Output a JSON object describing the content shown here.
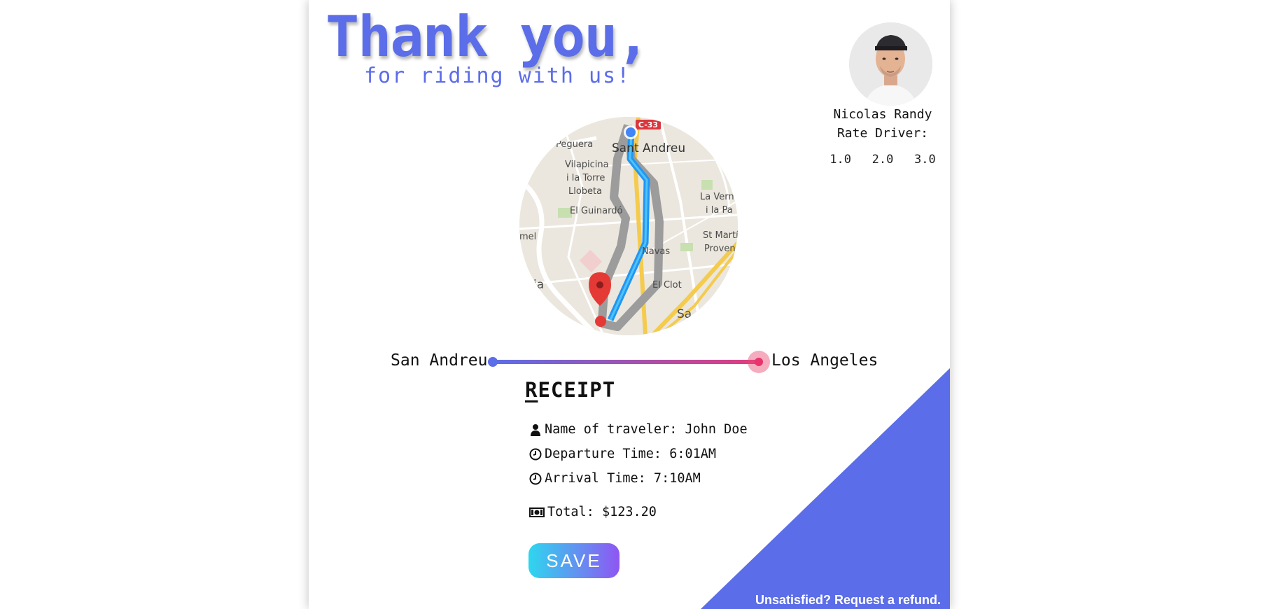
{
  "header": {
    "title": "Thank you,",
    "subtitle": "for riding with us!"
  },
  "driver": {
    "name": "Nicolas Randy",
    "rate_label": "Rate Driver:",
    "rating_options": [
      "1.0",
      "2.0",
      "3.0"
    ]
  },
  "map": {
    "labels": {
      "road_badge": "C-33",
      "peguera": "Peguera",
      "sant_andreu": "Sant Andreu",
      "vilapicina_1": "Vilapicina",
      "vilapicina_2": "i la Torre",
      "vilapicina_3": "Llobeta",
      "la_vern_1": "La Vern",
      "la_vern_2": "i la Pa",
      "el_guinardo": "El Guinardó",
      "el_left": "mel",
      "st_marti_1": "St Martí de",
      "st_marti_2": "Provençals",
      "navas": "Navas",
      "el_clot": "El Clot",
      "ia": "ia",
      "sa": "Sa"
    }
  },
  "route": {
    "from": "San Andreu",
    "to": "Los Angeles",
    "progress": 1.0
  },
  "receipt": {
    "title_first": "R",
    "title_rest": "ECEIPT",
    "traveler": "Name of traveler: John Doe",
    "departure": "Departure Time: 6:01AM",
    "arrival": "Arrival Time: 7:10AM",
    "total": "Total: $123.20"
  },
  "actions": {
    "save_label": "SAVE",
    "refund_label": "Unsatisfied? Request a refund."
  },
  "colors": {
    "accent": "#5b6de8",
    "route_end": "#e8336d",
    "save_gradient_start": "#2ed6ef",
    "save_gradient_end": "#8f56f2"
  }
}
